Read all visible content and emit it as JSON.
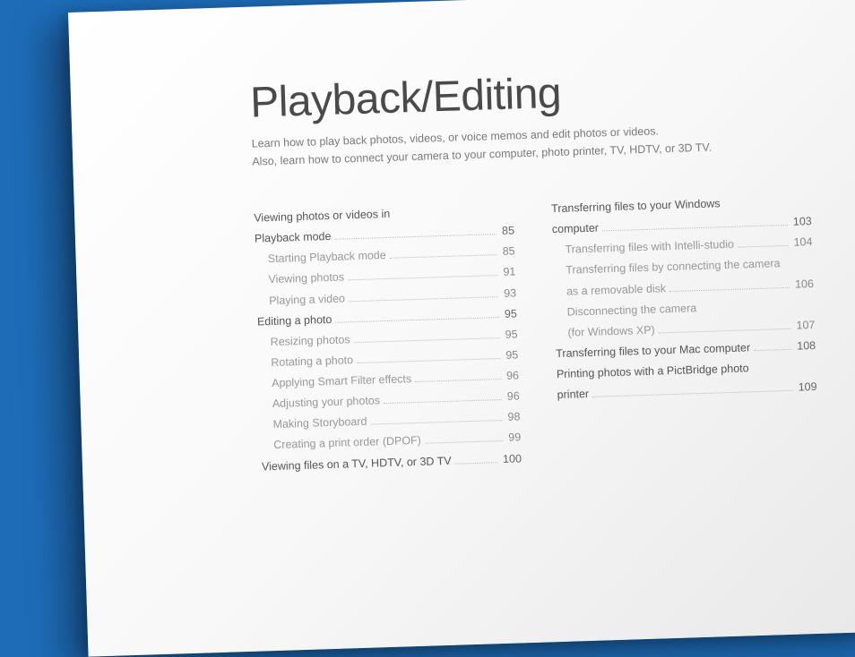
{
  "title": "Playback/Editing",
  "subtitle_line1": "Learn how to play back photos, videos, or voice memos and edit photos or videos.",
  "subtitle_line2": "Also, learn how to connect your camera to your computer, photo printer, TV, HDTV, or 3D TV.",
  "col1": {
    "e0": {
      "label": "Viewing photos or videos in"
    },
    "e1": {
      "label": "Playback mode",
      "page": "85"
    },
    "e2": {
      "label": "Starting Playback mode",
      "page": "85"
    },
    "e3": {
      "label": "Viewing photos",
      "page": "91"
    },
    "e4": {
      "label": "Playing a video",
      "page": "93"
    },
    "e5": {
      "label": "Editing a photo",
      "page": "95"
    },
    "e6": {
      "label": "Resizing photos",
      "page": "95"
    },
    "e7": {
      "label": "Rotating a photo",
      "page": "95"
    },
    "e8": {
      "label": "Applying Smart Filter effects",
      "page": "96"
    },
    "e9": {
      "label": "Adjusting your photos",
      "page": "96"
    },
    "e10": {
      "label": "Making Storyboard",
      "page": "98"
    },
    "e11": {
      "label": "Creating a print order (DPOF)",
      "page": "99"
    },
    "e12": {
      "label": "Viewing files on a TV, HDTV, or 3D TV",
      "page": "100"
    }
  },
  "col2": {
    "e0": {
      "label": "Transferring files to your Windows"
    },
    "e1": {
      "label": "computer",
      "page": "103"
    },
    "e2": {
      "label": "Transferring files with Intelli-studio",
      "page": "104"
    },
    "e3": {
      "line1": "Transferring files by connecting the camera",
      "line2": "as a removable disk",
      "page": "106"
    },
    "e4": {
      "line1": "Disconnecting the camera",
      "line2": "(for Windows XP)",
      "page": "107"
    },
    "e5": {
      "label": "Transferring files to your Mac computer",
      "page": "108"
    },
    "e6": {
      "label": "Printing photos with a PictBridge photo"
    },
    "e7": {
      "label": "printer",
      "page": "109"
    }
  }
}
